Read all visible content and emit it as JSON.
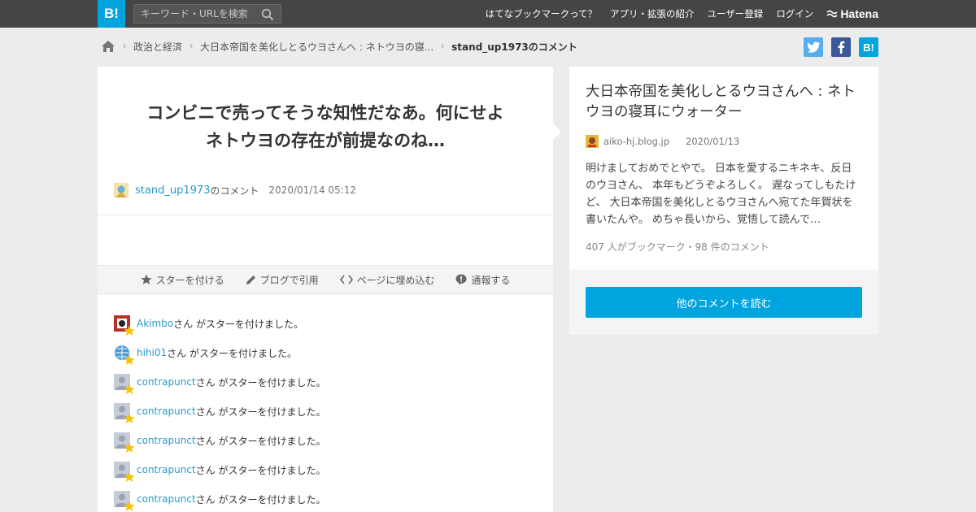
{
  "topbar": {
    "logo": "B!",
    "search_placeholder": "キーワード・URLを検索",
    "nav": [
      "はてなブックマークって？",
      "アプリ・拡張の紹介",
      "ユーザー登録",
      "ログイン"
    ],
    "hatena": "Hatena"
  },
  "breadcrumb": {
    "category": "政治と経済",
    "entry": "大日本帝国を美化しとるウヨさんへ : ネトウヨの寝...",
    "current": "stand_up1973のコメント"
  },
  "share": {
    "twitter": "t",
    "facebook": "f",
    "hatena": "B!"
  },
  "comment": {
    "line1": "コンビニで売ってそうな知性だなあ。何にせよ",
    "line2": "ネトウヨの存在が前提なのね…",
    "user": "stand_up1973",
    "suffix": "のコメント",
    "timestamp": "2020/01/14 05:12"
  },
  "actions": {
    "star": "スターを付ける",
    "blog": "ブログで引用",
    "embed": "ページに埋め込む",
    "report": "通報する"
  },
  "stars": {
    "suffix": "さん がスターを付けました。",
    "users": [
      "Akimbo",
      "hihi01",
      "contrapunct",
      "contrapunct",
      "contrapunct",
      "contrapunct",
      "contrapunct"
    ]
  },
  "entry": {
    "title": "大日本帝国を美化しとるウヨさんへ : ネトウヨの寝耳にウォーター",
    "domain": "aiko-hj.blog.jp",
    "date": "2020/01/13",
    "summary": "明けましておめでとやで。 日本を愛するニキネキ、反日のウヨさん、 本年もどうぞよろしく。 遅なってしもたけど、 大日本帝国を美化しとるウヨさんへ宛てた年賀状を書いたんや。 めちゃ長いから、覚悟して読んで…",
    "counts": "407 人がブックマーク・98 件のコメント",
    "read_more": "他のコメントを読む"
  },
  "colors": {
    "accent": "#00a4de",
    "topbar": "#454545",
    "link": "#2a9bc7",
    "star": "#f5c400",
    "twitter": "#55acee",
    "facebook": "#3b5998"
  }
}
